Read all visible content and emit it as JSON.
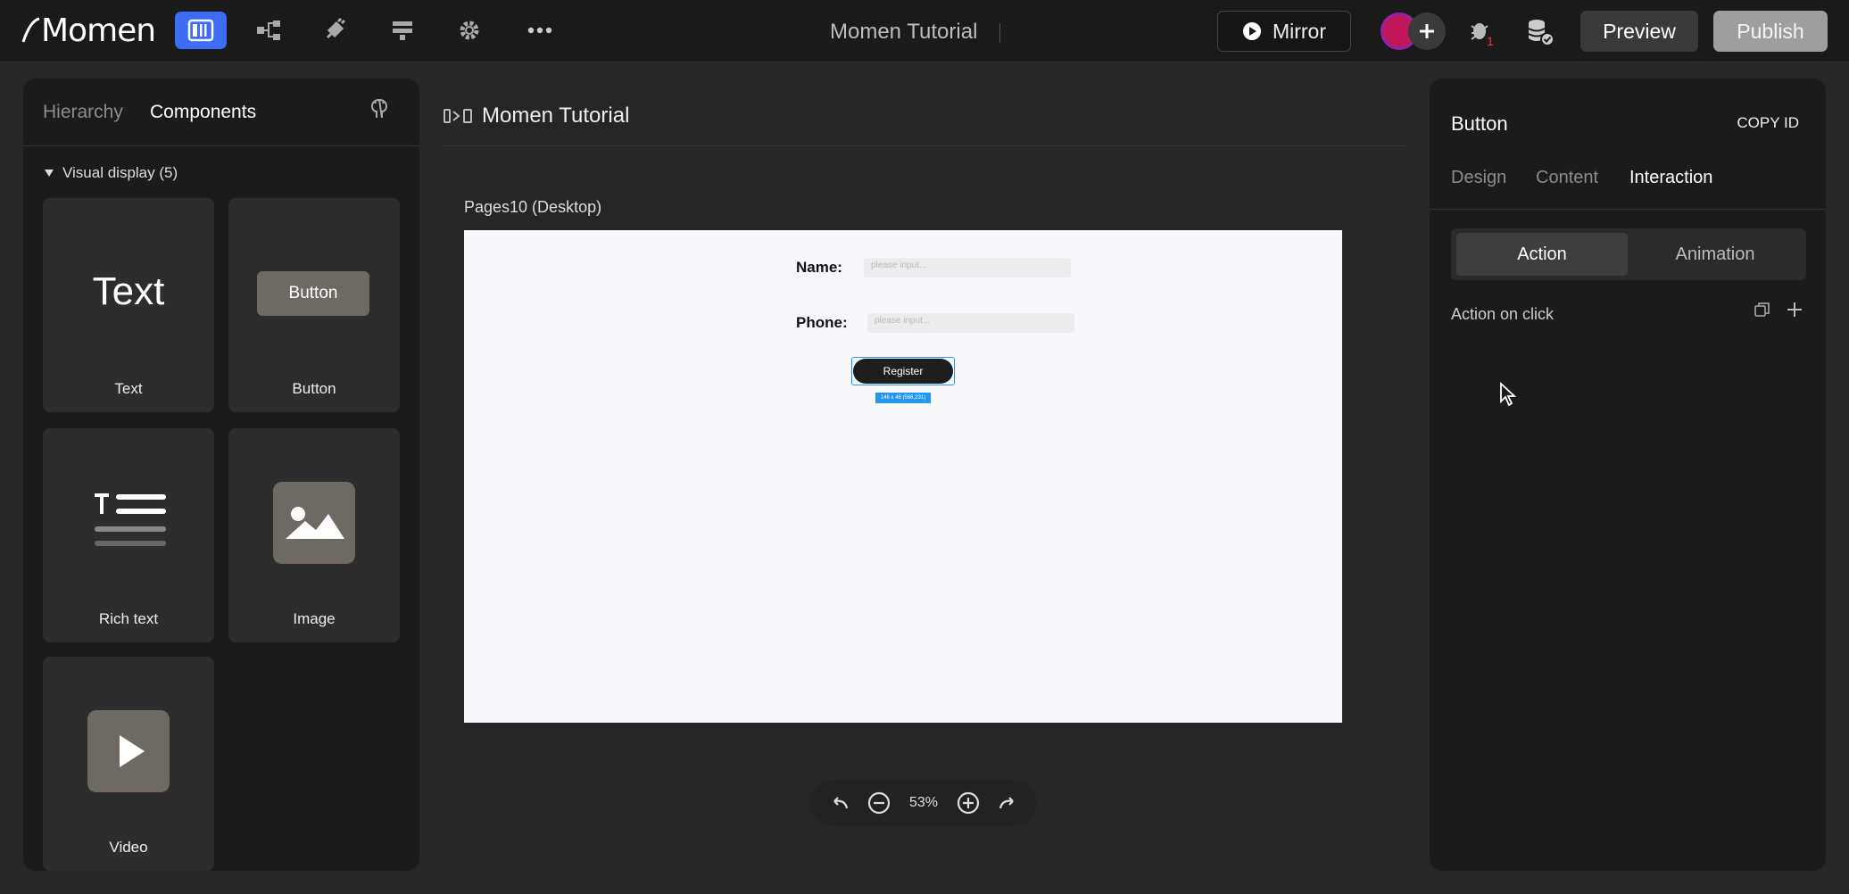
{
  "topbar": {
    "logo": "Momen",
    "title": "Momen Tutorial",
    "mirror_label": "Mirror",
    "preview_label": "Preview",
    "publish_label": "Publish",
    "badge_count": "1",
    "accent_color": "#3e6df5"
  },
  "left_panel": {
    "tabs": [
      {
        "label": "Hierarchy",
        "active": false
      },
      {
        "label": "Components",
        "active": true
      }
    ],
    "section_title": "Visual display (5)",
    "components": [
      {
        "label": "Text",
        "preview_text": "Text",
        "icon": "text-icon"
      },
      {
        "label": "Button",
        "preview_text": "Button",
        "icon": "button-icon"
      },
      {
        "label": "Rich text",
        "icon": "rich-text-icon"
      },
      {
        "label": "Image",
        "icon": "image-icon"
      },
      {
        "label": "Video",
        "icon": "play-icon"
      }
    ]
  },
  "canvas": {
    "header_title": "Momen Tutorial",
    "page_label": "Pages10 (Desktop)",
    "form": {
      "name_label": "Name:",
      "name_placeholder": "please input...",
      "phone_label": "Phone:",
      "phone_placeholder": "please input...",
      "register_label": "Register",
      "selection_badge": "146 x 46 (566,231)"
    },
    "zoom": "53%"
  },
  "right_panel": {
    "title": "Button",
    "copy_id_label": "COPY ID",
    "tabs": [
      {
        "label": "Design",
        "active": false
      },
      {
        "label": "Content",
        "active": false
      },
      {
        "label": "Interaction",
        "active": true
      }
    ],
    "segments": [
      {
        "label": "Action",
        "active": true
      },
      {
        "label": "Animation",
        "active": false
      }
    ],
    "action_on_click_label": "Action on click"
  }
}
